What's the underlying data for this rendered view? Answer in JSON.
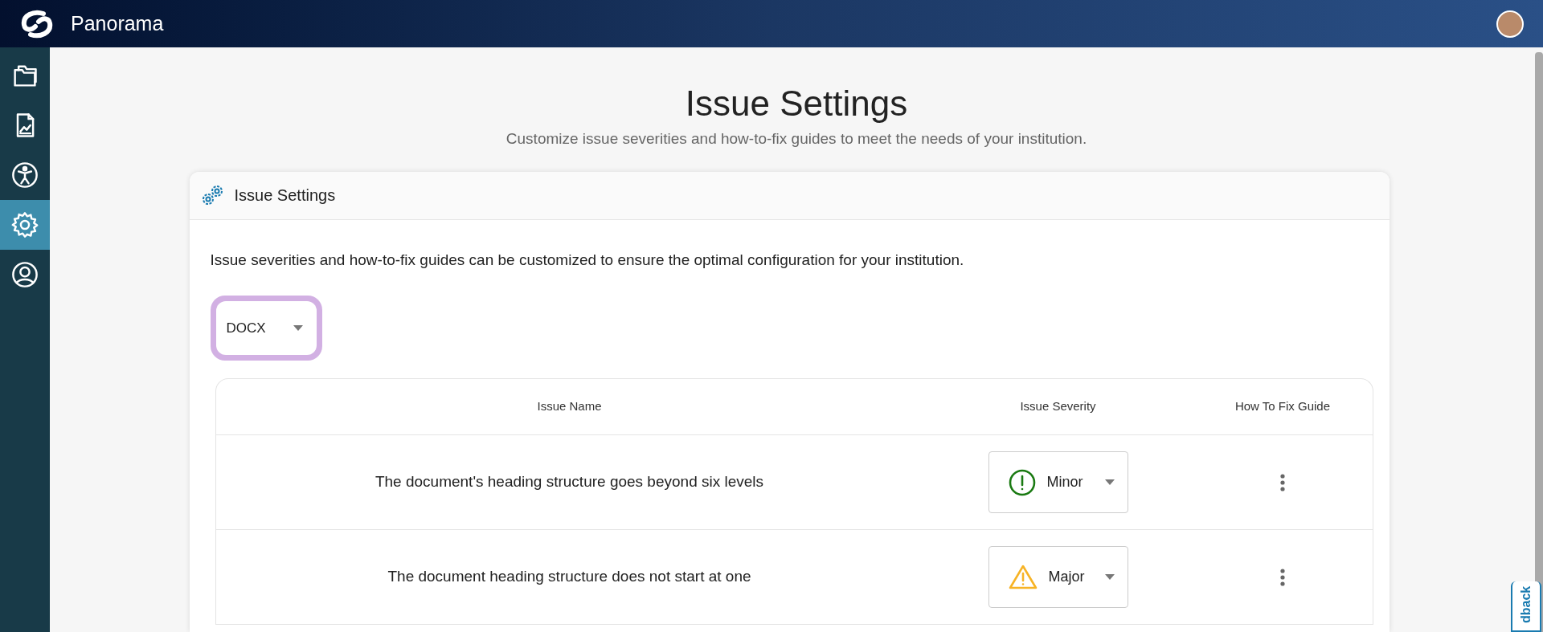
{
  "app": {
    "name": "Panorama"
  },
  "sidebar": {
    "items": [
      {
        "kind": "folders",
        "selected": false
      },
      {
        "kind": "report",
        "selected": false
      },
      {
        "kind": "accessibility",
        "selected": false
      },
      {
        "kind": "settings",
        "selected": true
      },
      {
        "kind": "user",
        "selected": false
      }
    ]
  },
  "page": {
    "title": "Issue Settings",
    "subtitle": "Customize issue severities and how-to-fix guides to meet the needs of your institution."
  },
  "card": {
    "title": "Issue Settings",
    "description": "Issue severities and how-to-fix guides can be customized to ensure the optimal configuration for your institution.",
    "format_select": {
      "value": "DOCX",
      "focused": true
    },
    "table": {
      "columns": [
        "Issue Name",
        "Issue Severity",
        "How To Fix Guide"
      ],
      "rows": [
        {
          "issue_name": "The document's heading structure goes beyond six levels",
          "severity": {
            "label": "Minor",
            "kind": "minor"
          }
        },
        {
          "issue_name": "The document heading structure does not start at one",
          "severity": {
            "label": "Major",
            "kind": "major"
          }
        }
      ]
    }
  },
  "feedback_tab": {
    "label": "dback"
  }
}
